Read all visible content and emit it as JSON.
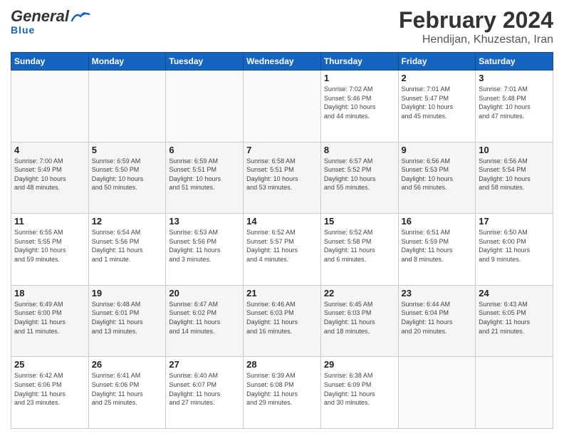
{
  "header": {
    "logo_general": "General",
    "logo_blue": "Blue",
    "month_title": "February 2024",
    "location": "Hendijan, Khuzestan, Iran"
  },
  "weekdays": [
    "Sunday",
    "Monday",
    "Tuesday",
    "Wednesday",
    "Thursday",
    "Friday",
    "Saturday"
  ],
  "weeks": [
    [
      {
        "day": "",
        "info": ""
      },
      {
        "day": "",
        "info": ""
      },
      {
        "day": "",
        "info": ""
      },
      {
        "day": "",
        "info": ""
      },
      {
        "day": "1",
        "info": "Sunrise: 7:02 AM\nSunset: 5:46 PM\nDaylight: 10 hours\nand 44 minutes."
      },
      {
        "day": "2",
        "info": "Sunrise: 7:01 AM\nSunset: 5:47 PM\nDaylight: 10 hours\nand 45 minutes."
      },
      {
        "day": "3",
        "info": "Sunrise: 7:01 AM\nSunset: 5:48 PM\nDaylight: 10 hours\nand 47 minutes."
      }
    ],
    [
      {
        "day": "4",
        "info": "Sunrise: 7:00 AM\nSunset: 5:49 PM\nDaylight: 10 hours\nand 48 minutes."
      },
      {
        "day": "5",
        "info": "Sunrise: 6:59 AM\nSunset: 5:50 PM\nDaylight: 10 hours\nand 50 minutes."
      },
      {
        "day": "6",
        "info": "Sunrise: 6:59 AM\nSunset: 5:51 PM\nDaylight: 10 hours\nand 51 minutes."
      },
      {
        "day": "7",
        "info": "Sunrise: 6:58 AM\nSunset: 5:51 PM\nDaylight: 10 hours\nand 53 minutes."
      },
      {
        "day": "8",
        "info": "Sunrise: 6:57 AM\nSunset: 5:52 PM\nDaylight: 10 hours\nand 55 minutes."
      },
      {
        "day": "9",
        "info": "Sunrise: 6:56 AM\nSunset: 5:53 PM\nDaylight: 10 hours\nand 56 minutes."
      },
      {
        "day": "10",
        "info": "Sunrise: 6:56 AM\nSunset: 5:54 PM\nDaylight: 10 hours\nand 58 minutes."
      }
    ],
    [
      {
        "day": "11",
        "info": "Sunrise: 6:55 AM\nSunset: 5:55 PM\nDaylight: 10 hours\nand 59 minutes."
      },
      {
        "day": "12",
        "info": "Sunrise: 6:54 AM\nSunset: 5:56 PM\nDaylight: 11 hours\nand 1 minute."
      },
      {
        "day": "13",
        "info": "Sunrise: 6:53 AM\nSunset: 5:56 PM\nDaylight: 11 hours\nand 3 minutes."
      },
      {
        "day": "14",
        "info": "Sunrise: 6:52 AM\nSunset: 5:57 PM\nDaylight: 11 hours\nand 4 minutes."
      },
      {
        "day": "15",
        "info": "Sunrise: 6:52 AM\nSunset: 5:58 PM\nDaylight: 11 hours\nand 6 minutes."
      },
      {
        "day": "16",
        "info": "Sunrise: 6:51 AM\nSunset: 5:59 PM\nDaylight: 11 hours\nand 8 minutes."
      },
      {
        "day": "17",
        "info": "Sunrise: 6:50 AM\nSunset: 6:00 PM\nDaylight: 11 hours\nand 9 minutes."
      }
    ],
    [
      {
        "day": "18",
        "info": "Sunrise: 6:49 AM\nSunset: 6:00 PM\nDaylight: 11 hours\nand 11 minutes."
      },
      {
        "day": "19",
        "info": "Sunrise: 6:48 AM\nSunset: 6:01 PM\nDaylight: 11 hours\nand 13 minutes."
      },
      {
        "day": "20",
        "info": "Sunrise: 6:47 AM\nSunset: 6:02 PM\nDaylight: 11 hours\nand 14 minutes."
      },
      {
        "day": "21",
        "info": "Sunrise: 6:46 AM\nSunset: 6:03 PM\nDaylight: 11 hours\nand 16 minutes."
      },
      {
        "day": "22",
        "info": "Sunrise: 6:45 AM\nSunset: 6:03 PM\nDaylight: 11 hours\nand 18 minutes."
      },
      {
        "day": "23",
        "info": "Sunrise: 6:44 AM\nSunset: 6:04 PM\nDaylight: 11 hours\nand 20 minutes."
      },
      {
        "day": "24",
        "info": "Sunrise: 6:43 AM\nSunset: 6:05 PM\nDaylight: 11 hours\nand 21 minutes."
      }
    ],
    [
      {
        "day": "25",
        "info": "Sunrise: 6:42 AM\nSunset: 6:06 PM\nDaylight: 11 hours\nand 23 minutes."
      },
      {
        "day": "26",
        "info": "Sunrise: 6:41 AM\nSunset: 6:06 PM\nDaylight: 11 hours\nand 25 minutes."
      },
      {
        "day": "27",
        "info": "Sunrise: 6:40 AM\nSunset: 6:07 PM\nDaylight: 11 hours\nand 27 minutes."
      },
      {
        "day": "28",
        "info": "Sunrise: 6:39 AM\nSunset: 6:08 PM\nDaylight: 11 hours\nand 29 minutes."
      },
      {
        "day": "29",
        "info": "Sunrise: 6:38 AM\nSunset: 6:09 PM\nDaylight: 11 hours\nand 30 minutes."
      },
      {
        "day": "",
        "info": ""
      },
      {
        "day": "",
        "info": ""
      }
    ]
  ]
}
